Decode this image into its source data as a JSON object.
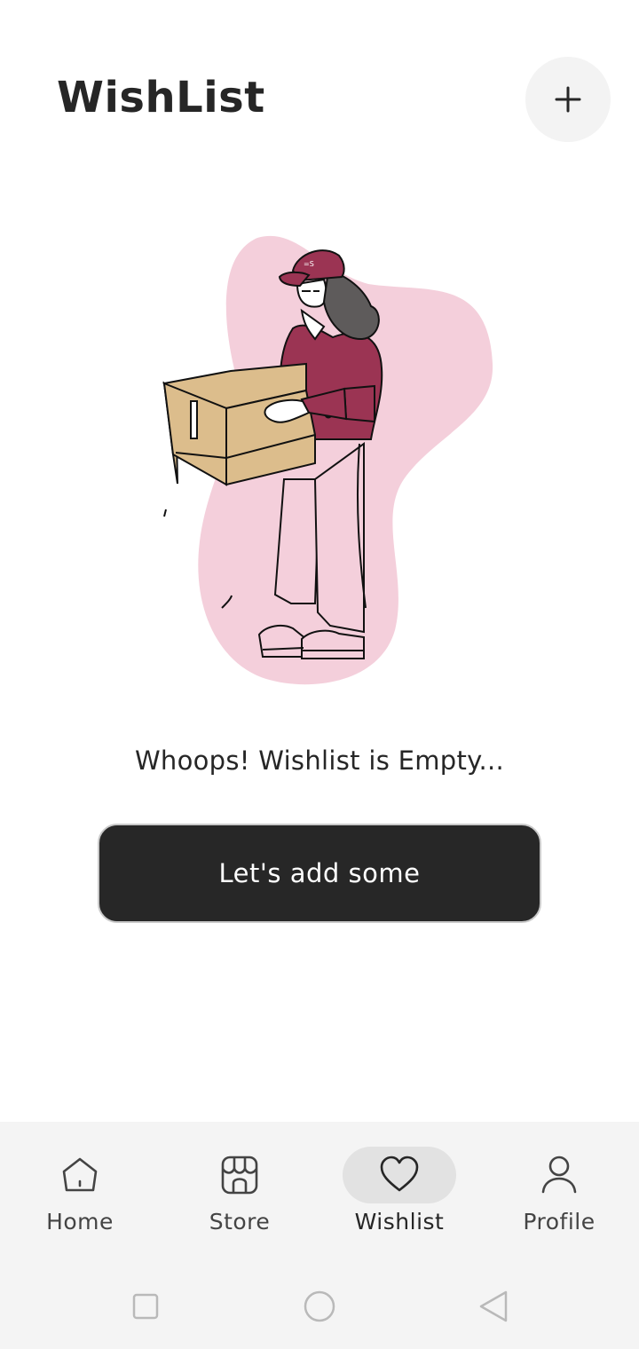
{
  "header": {
    "title": "WishList",
    "add_icon": "plus-icon"
  },
  "empty_state": {
    "illustration": "woman-holding-box-illustration",
    "message": "Whoops! Wishlist is Empty...",
    "cta_label": "Let's add some"
  },
  "bottom_nav": {
    "items": [
      {
        "label": "Home",
        "icon": "home-icon",
        "active": false
      },
      {
        "label": "Store",
        "icon": "store-icon",
        "active": false
      },
      {
        "label": "Wishlist",
        "icon": "heart-icon",
        "active": true
      },
      {
        "label": "Profile",
        "icon": "person-icon",
        "active": false
      }
    ]
  },
  "system_nav": {
    "buttons": [
      "recent-apps-icon",
      "home-circle-icon",
      "back-triangle-icon"
    ]
  },
  "colors": {
    "primary_dark": "#272727",
    "nav_bg": "#f4f4f4",
    "active_pill": "#e2e2e2",
    "blob_pink": "#f4cfdb",
    "shirt_maroon": "#9b3453",
    "box_tan": "#dcbd8c"
  }
}
